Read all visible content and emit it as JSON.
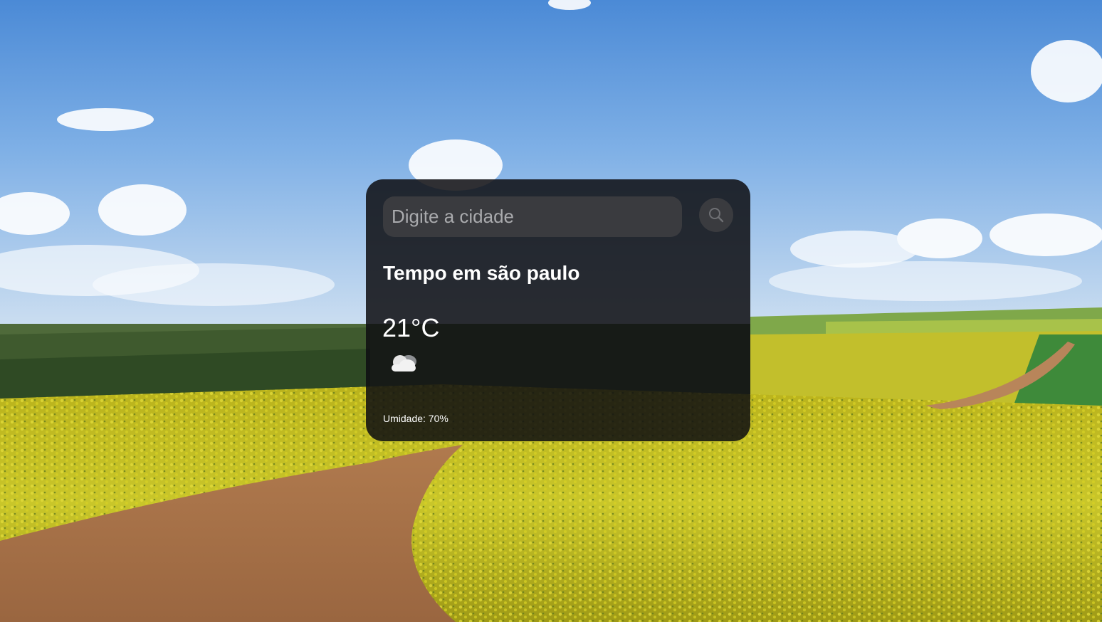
{
  "search": {
    "placeholder": "Digite a cidade",
    "value": ""
  },
  "weather": {
    "title": "Tempo em são paulo",
    "temperature": "21°C",
    "condition_icon": "cloud-icon",
    "humidity": "Umidade: 70%"
  },
  "icons": {
    "search_button": "search-icon"
  },
  "colors": {
    "card_background": "#0e0e12",
    "input_background": "#3a3b3f",
    "text": "#ffffff",
    "placeholder": "#a9aaad"
  }
}
